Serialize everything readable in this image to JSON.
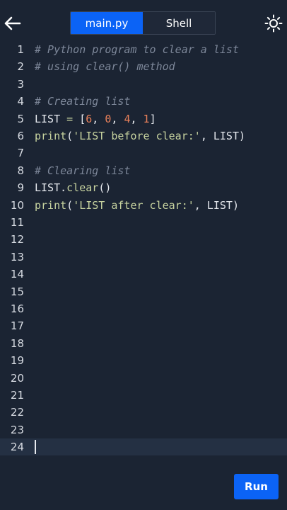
{
  "header": {
    "back_icon": "arrow-left-icon",
    "tabs": [
      {
        "label": "main.py",
        "active": true
      },
      {
        "label": "Shell",
        "active": false
      }
    ],
    "theme_icon": "sun-icon"
  },
  "editor": {
    "current_line": 24,
    "lines": [
      {
        "n": "1",
        "parts": [
          {
            "t": "# Python program to clear a list",
            "c": "cmt"
          }
        ]
      },
      {
        "n": "2",
        "parts": [
          {
            "t": "# using clear() method",
            "c": "cmt"
          }
        ]
      },
      {
        "n": "3",
        "parts": []
      },
      {
        "n": "4",
        "parts": [
          {
            "t": "# Creating list",
            "c": "cmt"
          }
        ]
      },
      {
        "n": "5",
        "parts": [
          {
            "t": "LIST ",
            "c": ""
          },
          {
            "t": "=",
            "c": "op"
          },
          {
            "t": " [",
            "c": ""
          },
          {
            "t": "6",
            "c": "num"
          },
          {
            "t": ", ",
            "c": ""
          },
          {
            "t": "0",
            "c": "num"
          },
          {
            "t": ", ",
            "c": ""
          },
          {
            "t": "4",
            "c": "num"
          },
          {
            "t": ", ",
            "c": ""
          },
          {
            "t": "1",
            "c": "num"
          },
          {
            "t": "]",
            "c": ""
          }
        ]
      },
      {
        "n": "6",
        "parts": [
          {
            "t": "print",
            "c": "fn"
          },
          {
            "t": "(",
            "c": ""
          },
          {
            "t": "'LIST before clear:'",
            "c": "str"
          },
          {
            "t": ", LIST)",
            "c": ""
          }
        ]
      },
      {
        "n": "7",
        "parts": []
      },
      {
        "n": "8",
        "parts": [
          {
            "t": "# Clearing list",
            "c": "cmt"
          }
        ]
      },
      {
        "n": "9",
        "parts": [
          {
            "t": "LIST.",
            "c": ""
          },
          {
            "t": "clear",
            "c": "fn"
          },
          {
            "t": "()",
            "c": ""
          }
        ]
      },
      {
        "n": "10",
        "parts": [
          {
            "t": "print",
            "c": "fn"
          },
          {
            "t": "(",
            "c": ""
          },
          {
            "t": "'LIST after clear:'",
            "c": "str"
          },
          {
            "t": ", LIST)",
            "c": ""
          }
        ]
      },
      {
        "n": "11",
        "parts": []
      },
      {
        "n": "12",
        "parts": []
      },
      {
        "n": "13",
        "parts": []
      },
      {
        "n": "14",
        "parts": []
      },
      {
        "n": "15",
        "parts": []
      },
      {
        "n": "16",
        "parts": []
      },
      {
        "n": "17",
        "parts": []
      },
      {
        "n": "18",
        "parts": []
      },
      {
        "n": "19",
        "parts": []
      },
      {
        "n": "20",
        "parts": []
      },
      {
        "n": "21",
        "parts": []
      },
      {
        "n": "22",
        "parts": []
      },
      {
        "n": "23",
        "parts": []
      },
      {
        "n": "24",
        "parts": []
      }
    ]
  },
  "run_button": {
    "label": "Run"
  },
  "colors": {
    "accent": "#0b63f6",
    "background": "#1b2433"
  }
}
